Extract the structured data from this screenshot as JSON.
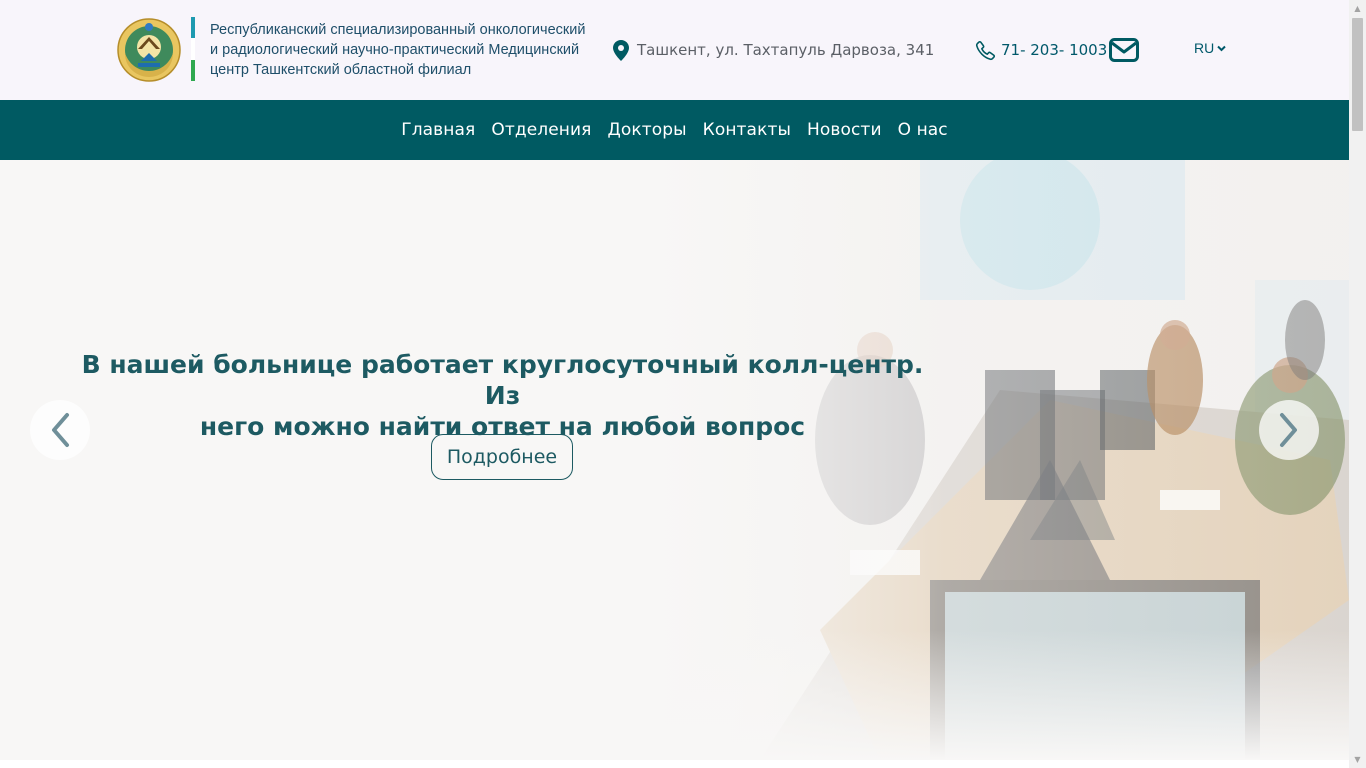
{
  "header": {
    "org_name_line1": "Республиканский специализированный онкологический",
    "org_name_line2": "и радиологический научно-практический Медицинский",
    "org_name_line3": "центр Ташкентский областной филиал",
    "address": "Ташкент, ул. Тахтапуль Дарвоза, 341",
    "phone": "71- 203- 1003",
    "language": "RU",
    "icons": [
      "emblem-logo",
      "map-pin-icon",
      "phone-icon",
      "mail-icon",
      "chevron-down-icon"
    ]
  },
  "nav": {
    "items": [
      "Главная",
      "Отделения",
      "Докторы",
      "Контакты",
      "Новости",
      "О нас"
    ]
  },
  "hero": {
    "title_line1": "В нашей больнице работает круглосуточный колл-центр. Из",
    "title_line2": "него можно найти ответ на любой вопрос",
    "button_label": "Подробнее",
    "icons": [
      "chevron-left-icon",
      "chevron-right-icon"
    ]
  },
  "colors": {
    "primary": "#005a62",
    "header_bg": "#f8f5fb",
    "hero_text": "#1d5a62",
    "flag_blue": "#1e9ab0",
    "flag_white": "#ffffff",
    "flag_green": "#2fa84f"
  }
}
